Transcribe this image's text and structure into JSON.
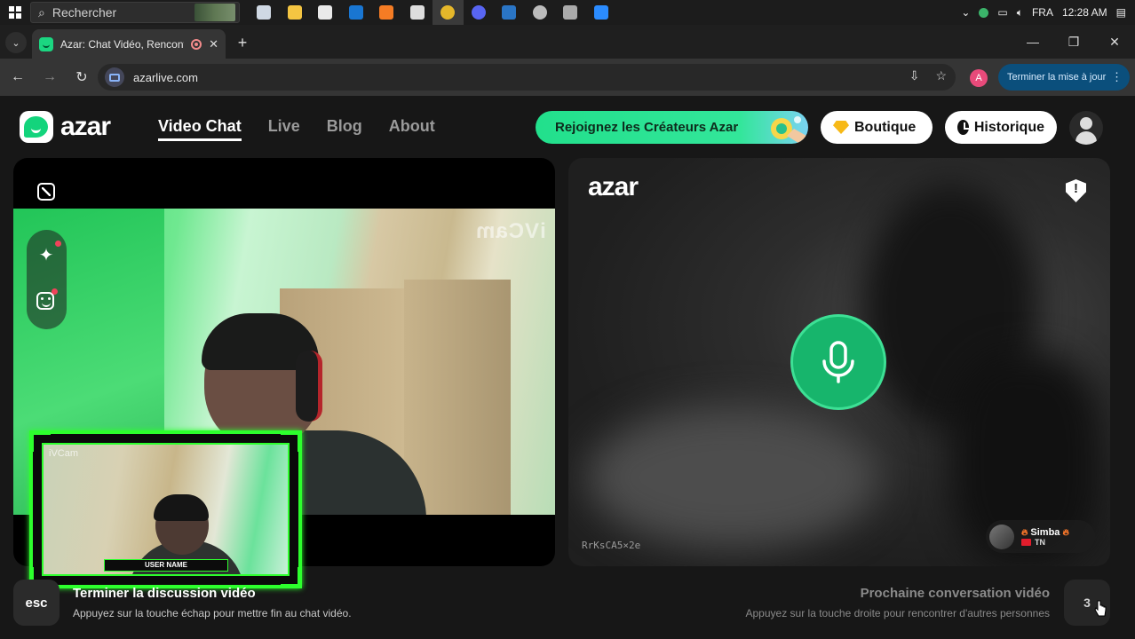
{
  "taskbar": {
    "search_placeholder": "Rechercher",
    "apps": [
      {
        "icon": "task-view-icon",
        "color": "#cfd8e3"
      },
      {
        "icon": "file-explorer-icon",
        "color": "#f4c542"
      },
      {
        "icon": "microsoft-store-icon",
        "color": "#e9e9e9"
      },
      {
        "icon": "outlook-icon",
        "color": "#1976d2"
      },
      {
        "icon": "app-orange-icon",
        "color": "#f57c24"
      },
      {
        "icon": "app-swirl-icon",
        "color": "#dddddd"
      },
      {
        "icon": "chrome-icon",
        "color": "#e5b72a"
      },
      {
        "icon": "discord-icon",
        "color": "#5865f2"
      },
      {
        "icon": "steam-icon",
        "color": "#2a75c5"
      },
      {
        "icon": "app-compass-icon",
        "color": "#bbbbbb"
      },
      {
        "icon": "app-speaker-icon",
        "color": "#aaaaaa"
      },
      {
        "icon": "app-blue-icon",
        "color": "#2b8cff"
      }
    ],
    "language": "FRA",
    "time": "12:28 AM"
  },
  "browser": {
    "tab_title": "Azar: Chat Vidéo, Rencontre",
    "url": "azarlive.com",
    "profile_initial": "A",
    "update_label": "Terminer la mise à jour"
  },
  "site": {
    "logo_text": "azar",
    "nav": [
      "Video Chat",
      "Live",
      "Blog",
      "About"
    ],
    "creators_label": "Rejoignez les Créateurs Azar",
    "shop_label": "Boutique",
    "history_label": "Historique"
  },
  "left_panel": {
    "watermark": "iVCam",
    "overlay_watermark": "iVCam",
    "overlay_username": "USER NAME"
  },
  "right_panel": {
    "logo_text": "azar",
    "peer_id": "RrKsCA5×2e",
    "peer_name": "Simba",
    "peer_country": "TN"
  },
  "hints": {
    "esc_key": "esc",
    "end_title": "Terminer la discussion vidéo",
    "end_sub": "Appuyez sur la touche échap pour mettre fin au chat vidéo.",
    "next_title": "Prochaine conversation vidéo",
    "next_sub": "Appuyez sur la touche droite pour rencontrer d'autres personnes",
    "next_key": "3"
  },
  "colors": {
    "brand_green": "#13d47c",
    "mic_green": "#17b56c",
    "overlay_green": "#2dff2d",
    "update_blue": "#0b4f7c"
  }
}
